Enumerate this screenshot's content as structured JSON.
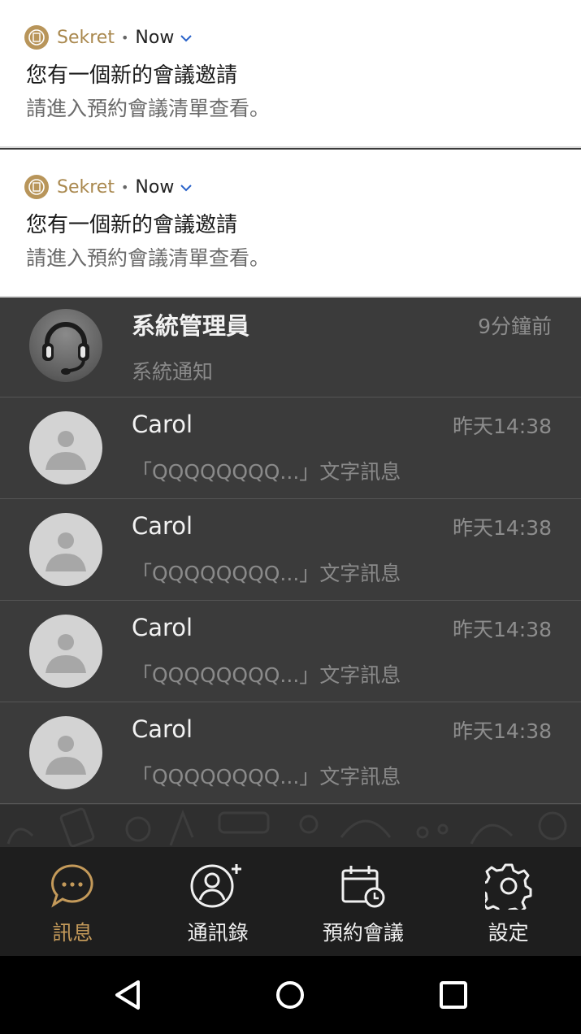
{
  "notifications": [
    {
      "app": "Sekret",
      "separator": "•",
      "time": "Now",
      "title": "您有一個新的會議邀請",
      "body": "請進入預約會議清單查看。"
    },
    {
      "app": "Sekret",
      "separator": "•",
      "time": "Now",
      "title": "您有一個新的會議邀請",
      "body": "請進入預約會議清單查看。"
    }
  ],
  "chats": [
    {
      "name": "系統管理員",
      "preview": "系統通知",
      "time": "9分鐘前",
      "avatar": "headset-icon"
    },
    {
      "name": "Carol",
      "preview": "「QQQQQQQQ...」文字訊息",
      "time": "昨天14:38",
      "avatar": "person-icon"
    },
    {
      "name": "Carol",
      "preview": "「QQQQQQQQ...」文字訊息",
      "time": "昨天14:38",
      "avatar": "person-icon"
    },
    {
      "name": "Carol",
      "preview": "「QQQQQQQQ...」文字訊息",
      "time": "昨天14:38",
      "avatar": "person-icon"
    },
    {
      "name": "Carol",
      "preview": "「QQQQQQQQ...」文字訊息",
      "time": "昨天14:38",
      "avatar": "person-icon"
    }
  ],
  "tabs": [
    {
      "label": "訊息",
      "icon": "chat-bubble-icon",
      "active": true
    },
    {
      "label": "通訊錄",
      "icon": "add-contact-icon",
      "active": false
    },
    {
      "label": "預約會議",
      "icon": "calendar-clock-icon",
      "active": false
    },
    {
      "label": "設定",
      "icon": "gear-icon",
      "active": false
    }
  ],
  "colors": {
    "accent": "#c49a5a",
    "list_bg": "#3b3b3b",
    "tabbar_bg": "#1e1e1e"
  }
}
